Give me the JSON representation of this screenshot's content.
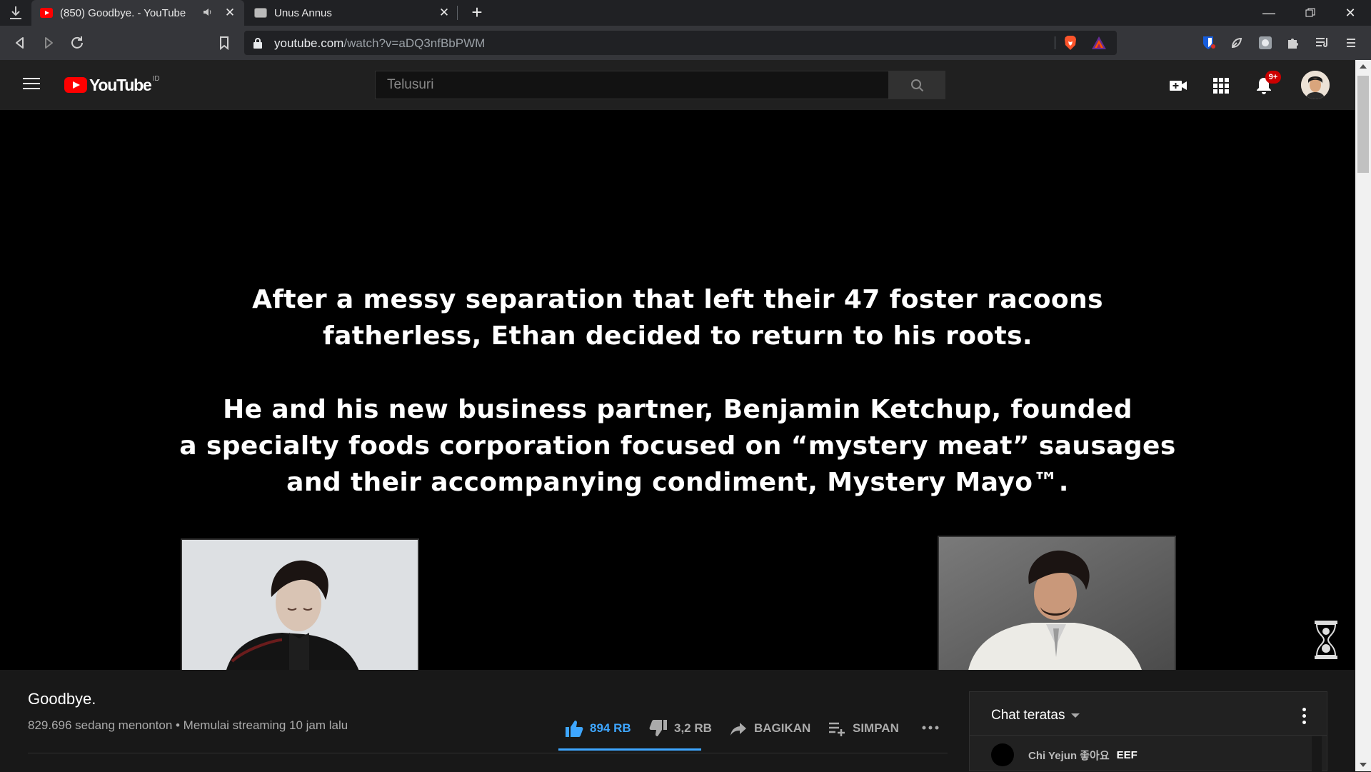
{
  "browser": {
    "tabs": [
      {
        "title": "(850) Goodbye. - YouTube",
        "active": true,
        "audio": true
      },
      {
        "title": "Unus Annus",
        "active": false
      }
    ],
    "url_host": "youtube.com",
    "url_path": "/watch?v=aDQ3nfBbPWM"
  },
  "masthead": {
    "logo_text": "YouTube",
    "region": "ID",
    "search_placeholder": "Telusuri",
    "notification_count": "9+"
  },
  "player": {
    "caption_lines": [
      "After a messy separation that left their 47 foster racoons",
      "fatherless, Ethan decided to return to his roots.",
      "He and his new business partner, Benjamin Ketchup, founded",
      "a specialty foods corporation focused on “mystery meat” sausages",
      "and their accompanying condiment, Mystery Mayo™."
    ]
  },
  "video": {
    "title": "Goodbye.",
    "meta": "829.696 sedang menonton • Memulai streaming 10 jam lalu",
    "likes": "894 RB",
    "dislikes": "3,2 RB",
    "share_label": "BAGIKAN",
    "save_label": "SIMPAN"
  },
  "chat": {
    "header": "Chat teratas",
    "messages": [
      {
        "author": "Chi Yejun 좋아요",
        "text": "EEF"
      }
    ]
  },
  "colors": {
    "accent_blue": "#3ea6ff",
    "youtube_red": "#ff0000",
    "badge_red": "#cc0000"
  }
}
